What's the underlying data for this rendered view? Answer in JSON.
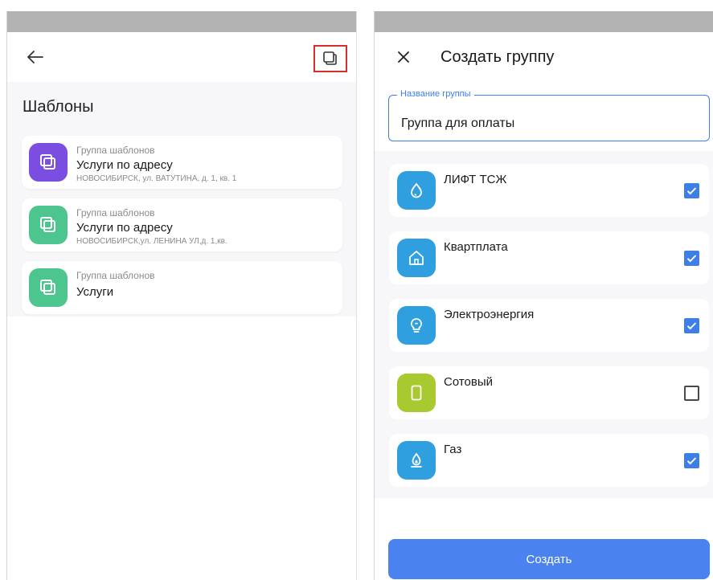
{
  "left": {
    "title": "Шаблоны",
    "templates": [
      {
        "subtitle": "Группа шаблонов",
        "name": "Услуги по адресу",
        "address": "НОВОСИБИРСК, ул. ВАТУТИНА, д. 1, кв. 1",
        "icon": "copy-icon",
        "color": "#7b4de0"
      },
      {
        "subtitle": "Группа шаблонов",
        "name": "Услуги по адресу",
        "address": "НОВОСИБИРСК,ул. ЛЕНИНА УЛ,д. 1,кв.",
        "icon": "copy-icon",
        "color": "#4cc68e"
      },
      {
        "subtitle": "Группа шаблонов",
        "name": "Услуги",
        "address": "",
        "icon": "copy-icon",
        "color": "#4cc68e"
      }
    ]
  },
  "right": {
    "title": "Создать группу",
    "name_field": {
      "label": "Название группы",
      "value": "Группа для оплаты"
    },
    "services": [
      {
        "label": "ЛИФТ ТСЖ",
        "icon": "water-drop-icon",
        "color": "#2f9fe0",
        "checked": true
      },
      {
        "label": "Квартплата",
        "icon": "house-icon",
        "color": "#2f9fe0",
        "checked": true
      },
      {
        "label": "Электроэнергия",
        "icon": "lightbulb-icon",
        "color": "#2f9fe0",
        "checked": true
      },
      {
        "label": "Сотовый",
        "icon": "phone-icon",
        "color": "#a9c931",
        "checked": false
      },
      {
        "label": "Газ",
        "icon": "gas-flame-icon",
        "color": "#2f9fe0",
        "checked": true
      }
    ],
    "create_label": "Создать"
  },
  "colors": {
    "accent": "#3d7fe6",
    "button": "#4a82f0",
    "highlight": "#d32f2f",
    "statusbar": "#b3b3b3"
  }
}
